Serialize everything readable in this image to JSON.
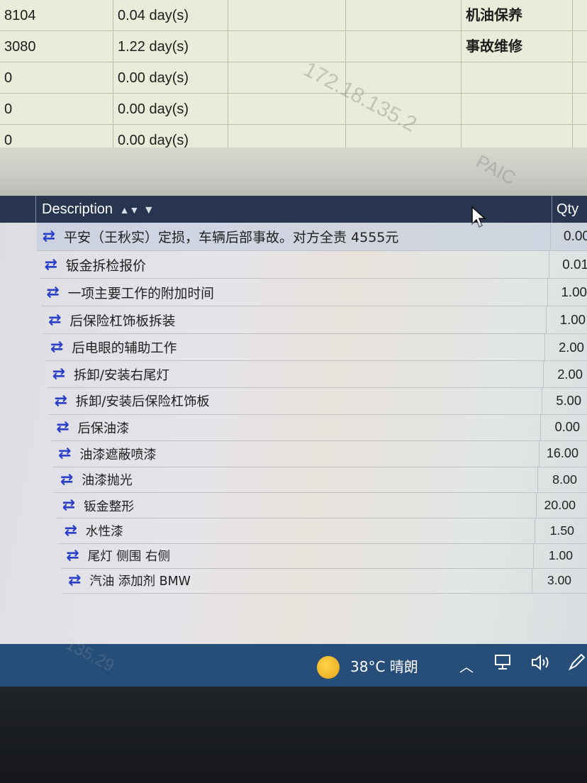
{
  "top_grid": {
    "rows": [
      {
        "id": "8104",
        "time": "0.04 day(s)",
        "type": "机油保养"
      },
      {
        "id": "3080",
        "time": "1.22 day(s)",
        "type": "事故维修"
      },
      {
        "id": "0",
        "time": "0.00 day(s)",
        "type": ""
      },
      {
        "id": "0",
        "time": "0.00 day(s)",
        "type": ""
      },
      {
        "id": "0",
        "time": "0.00 day(s)",
        "type": ""
      }
    ]
  },
  "watermarks": [
    "172.18.135.2",
    "PAIC",
    "135.29"
  ],
  "table": {
    "headers": {
      "description": "Description",
      "qty": "Qty"
    },
    "rows": [
      {
        "description": "平安（王秋实）定损，车辆后部事故。对方全责 4555元",
        "qty": "0.00"
      },
      {
        "description": "钣金拆检报价",
        "qty": "0.01"
      },
      {
        "description": "一项主要工作的附加时间",
        "qty": "1.00"
      },
      {
        "description": "后保险杠饰板拆装",
        "qty": "1.00"
      },
      {
        "description": "后电眼的辅助工作",
        "qty": "2.00"
      },
      {
        "description": "拆卸/安装右尾灯",
        "qty": "2.00"
      },
      {
        "description": "拆卸/安装后保险杠饰板",
        "qty": "5.00"
      },
      {
        "description": "后保油漆",
        "qty": "0.00"
      },
      {
        "description": "油漆遮蔽喷漆",
        "qty": "16.00"
      },
      {
        "description": "油漆抛光",
        "qty": "8.00"
      },
      {
        "description": "钣金整形",
        "qty": "20.00"
      },
      {
        "description": "水性漆",
        "qty": "1.50"
      },
      {
        "description": "尾灯 侧围 右侧",
        "qty": "1.00"
      },
      {
        "description": "汽油 添加剂 BMW",
        "qty": "3.00"
      }
    ],
    "row_icon": "swap-arrows-icon"
  },
  "taskbar": {
    "weather": "38°C  晴朗",
    "weather_icon": "sun-icon",
    "tray_icons": [
      "chevron-up-icon",
      "network-icon",
      "volume-icon",
      "pen-icon"
    ]
  }
}
